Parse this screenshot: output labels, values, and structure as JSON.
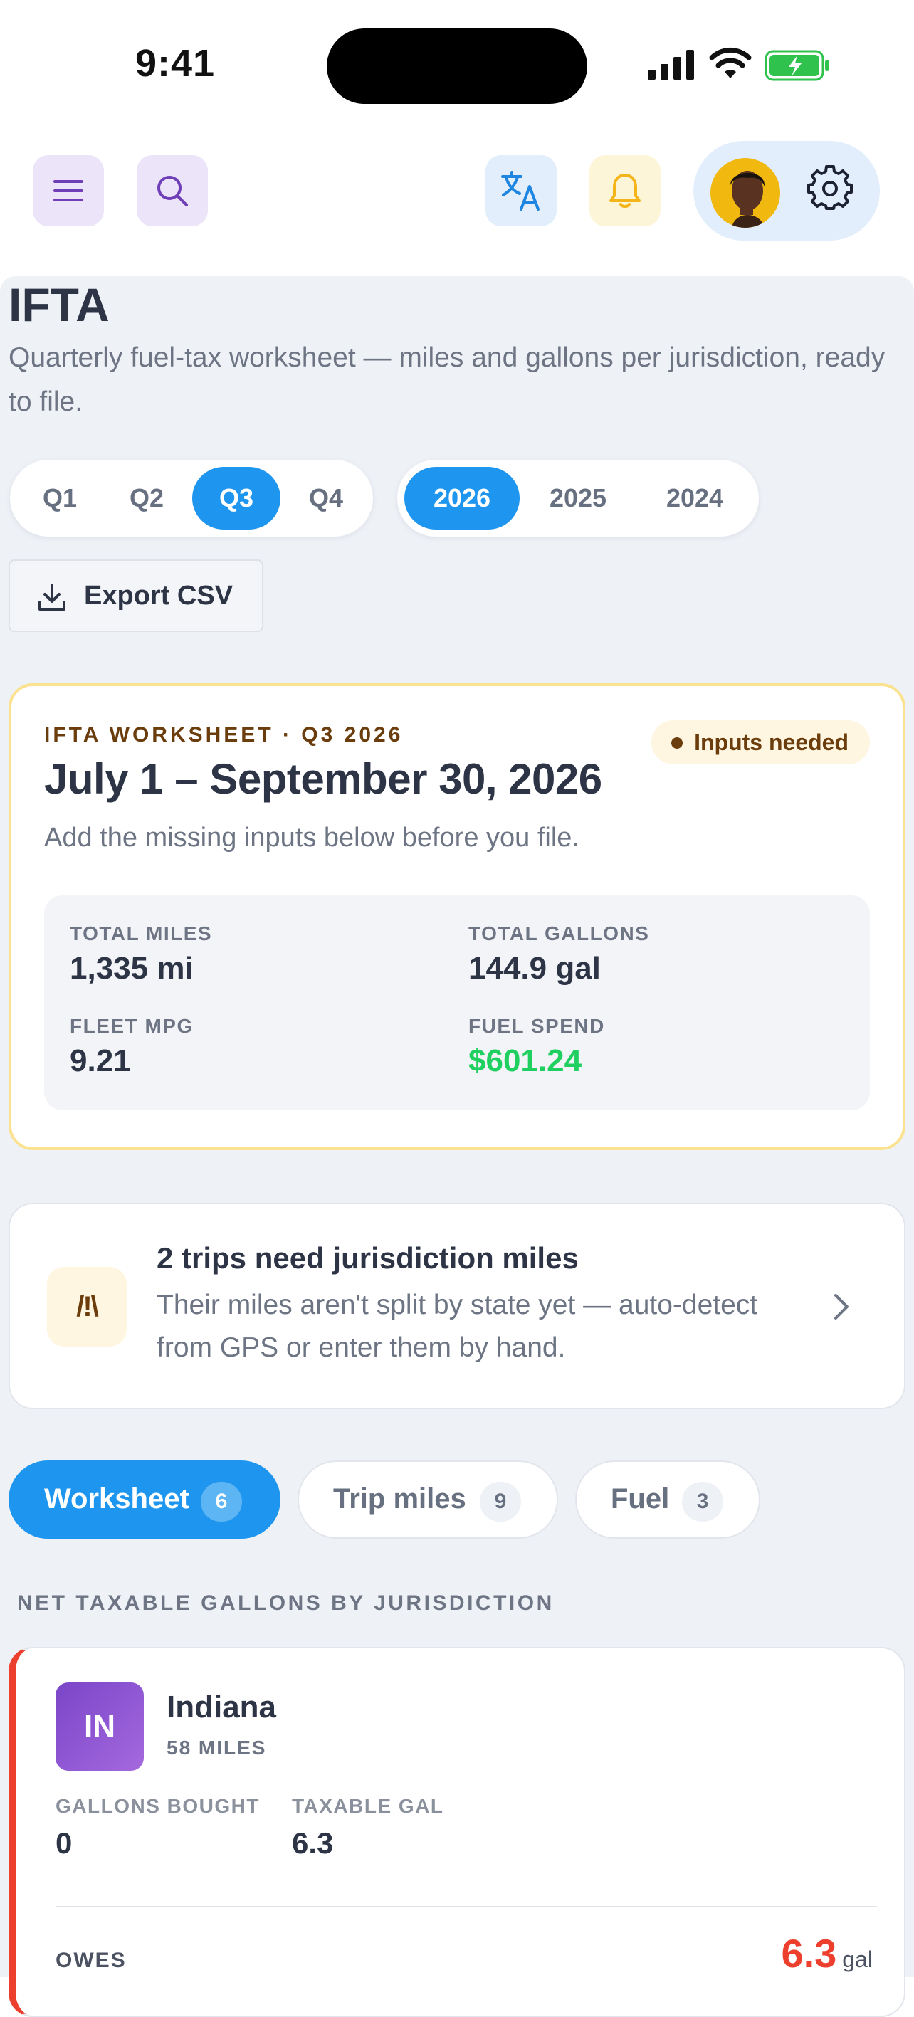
{
  "status_bar": {
    "time": "9:41"
  },
  "header": {
    "menu_icon": "menu-icon",
    "search_icon": "search-icon",
    "translate_icon": "translate-icon",
    "bell_icon": "bell-icon",
    "settings_icon": "gear-icon"
  },
  "page": {
    "title": "IFTA",
    "subtitle": "Quarterly fuel-tax worksheet — miles and gallons per jurisdiction, ready to file."
  },
  "quarters": [
    {
      "label": "Q1",
      "active": false
    },
    {
      "label": "Q2",
      "active": false
    },
    {
      "label": "Q3",
      "active": true
    },
    {
      "label": "Q4",
      "active": false
    }
  ],
  "years": [
    {
      "label": "2026",
      "active": true
    },
    {
      "label": "2025",
      "active": false
    },
    {
      "label": "2024",
      "active": false
    }
  ],
  "export": {
    "label": "Export CSV"
  },
  "worksheet": {
    "eyebrow": "IFTA WORKSHEET · Q3 2026",
    "badge": "Inputs needed",
    "range": "July 1 – September 30, 2026",
    "note": "Add the missing inputs below before you file.",
    "stats": [
      {
        "label": "TOTAL MILES",
        "value": "1,335 mi"
      },
      {
        "label": "TOTAL GALLONS",
        "value": "144.9 gal"
      },
      {
        "label": "FLEET MPG",
        "value": "9.21"
      },
      {
        "label": "FUEL SPEND",
        "value": "$601.24"
      }
    ],
    "colors": {
      "spend": "#1fd061",
      "badge_text": "#6b3d0c",
      "border": "#fbe291"
    }
  },
  "alert": {
    "icon_text": "/!\\",
    "title": "2 trips need jurisdiction miles",
    "body": "Their miles aren't split by state yet — auto-detect from GPS or enter them by hand."
  },
  "tabs": [
    {
      "label": "Worksheet",
      "count": "6",
      "active": true
    },
    {
      "label": "Trip miles",
      "count": "9",
      "active": false
    },
    {
      "label": "Fuel",
      "count": "3",
      "active": false
    }
  ],
  "section_heading": "NET TAXABLE GALLONS BY JURISDICTION",
  "jurisdiction": {
    "code": "IN",
    "name": "Indiana",
    "miles": "58 MILES",
    "gallons_bought_label": "GALLONS BOUGHT",
    "gallons_bought": "0",
    "taxable_label": "TAXABLE GAL",
    "taxable": "6.3",
    "owes_label": "OWES",
    "owes_value": "6.3",
    "owes_unit": "gal",
    "accent": "#ec3f2e"
  },
  "accent": "#1e96ef"
}
